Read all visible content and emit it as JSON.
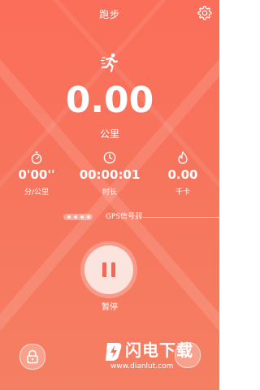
{
  "header": {
    "title": "跑步"
  },
  "main": {
    "distance_value": "0.00",
    "distance_unit": "公里"
  },
  "stats": [
    {
      "icon": "stopwatch-icon",
      "value": "0'00''",
      "label": "分/公里"
    },
    {
      "icon": "clock-icon",
      "value": "00:00:01",
      "label": "时长"
    },
    {
      "icon": "flame-icon",
      "value": "0.00",
      "label": "千卡"
    }
  ],
  "gps": {
    "text": "GPS信号弱"
  },
  "controls": {
    "pause_label": "暂停"
  },
  "watermark": {
    "name": "闪电下载",
    "url": "www.dianlut.com"
  },
  "colors": {
    "background": "#f8705a",
    "pause_icon": "#f26a56",
    "pause_bg": "#fbe3de"
  }
}
